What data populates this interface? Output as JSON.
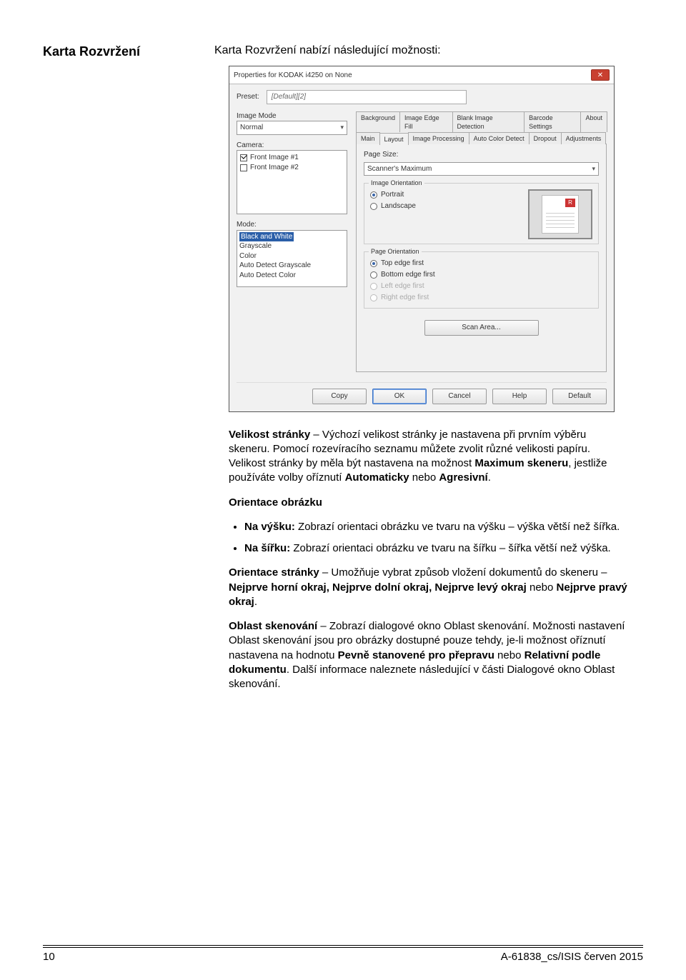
{
  "heading_left": "Karta Rozvržení",
  "heading_right": "Karta Rozvržení nabízí následující možnosti:",
  "dialog": {
    "title": "Properties for KODAK i4250 on None",
    "close_char": "✕",
    "preset_label": "Preset:",
    "preset_value": "[Default][2]",
    "left": {
      "image_mode_label": "Image Mode",
      "image_mode_value": "Normal",
      "camera_label": "Camera:",
      "camera_items": [
        "Front Image #1",
        "Front Image #2"
      ],
      "mode_label": "Mode:",
      "mode_items": [
        "Black and White",
        "Grayscale",
        "Color",
        "Auto Detect Grayscale",
        "Auto Detect Color"
      ]
    },
    "tabs_row1": [
      "Background",
      "Image Edge Fill",
      "Blank Image Detection",
      "Barcode Settings",
      "About"
    ],
    "tabs_row2": [
      "Main",
      "Layout",
      "Image Processing",
      "Auto Color Detect",
      "Dropout",
      "Adjustments"
    ],
    "layout": {
      "page_size_label": "Page Size:",
      "page_size_value": "Scanner's Maximum",
      "image_orientation_label": "Image Orientation",
      "image_orientation_opts": [
        "Portrait",
        "Landscape"
      ],
      "preview_badge": "R",
      "page_orientation_label": "Page Orientation",
      "page_orientation_opts": [
        "Top edge first",
        "Bottom edge first",
        "Left edge first",
        "Right edge first"
      ],
      "scan_area_btn": "Scan Area..."
    },
    "footer_buttons": [
      "Copy",
      "OK",
      "Cancel",
      "Help",
      "Default"
    ]
  },
  "body": {
    "p1_a": "Velikost stránky",
    "p1_b": " – Výchozí velikost stránky je nastavena při prvním výběru skeneru. Pomocí rozevíracího seznamu můžete zvolit různé velikosti papíru. Velikost stránky by měla být nastavena na možnost ",
    "p1_c": "Maximum skeneru",
    "p1_d": ", jestliže používáte volby oříznutí ",
    "p1_e": "Automaticky",
    "p1_f": " nebo ",
    "p1_g": "Agresivní",
    "p1_h": ".",
    "p2_a": "Orientace obrázku",
    "li1_a": "Na výšku:",
    "li1_b": " Zobrazí orientaci obrázku ve tvaru na výšku – výška větší než šířka.",
    "li2_a": "Na šířku:",
    "li2_b": " Zobrazí orientaci obrázku ve tvaru na šířku – šířka větší než výška.",
    "p3_a": "Orientace stránky",
    "p3_b": " – Umožňuje vybrat způsob vložení dokumentů do skeneru – ",
    "p3_c": "Nejprve horní okraj, Nejprve dolní okraj, Nejprve levý okraj",
    "p3_d": " nebo ",
    "p3_e": "Nejprve pravý okraj",
    "p3_f": ".",
    "p4_a": "Oblast skenování",
    "p4_b": " – Zobrazí dialogové okno Oblast skenování. Možnosti nastavení Oblast skenování jsou pro obrázky dostupné pouze tehdy, je-li možnost oříznutí nastavena na hodnotu ",
    "p4_c": "Pevně stanovené pro přepravu",
    "p4_d": " nebo ",
    "p4_e": "Relativní podle dokumentu",
    "p4_f": ". Další informace naleznete následující v části Dialogové okno Oblast skenování."
  },
  "footer": {
    "page": "10",
    "right": "A-61838_cs/ISIS  červen 2015"
  }
}
